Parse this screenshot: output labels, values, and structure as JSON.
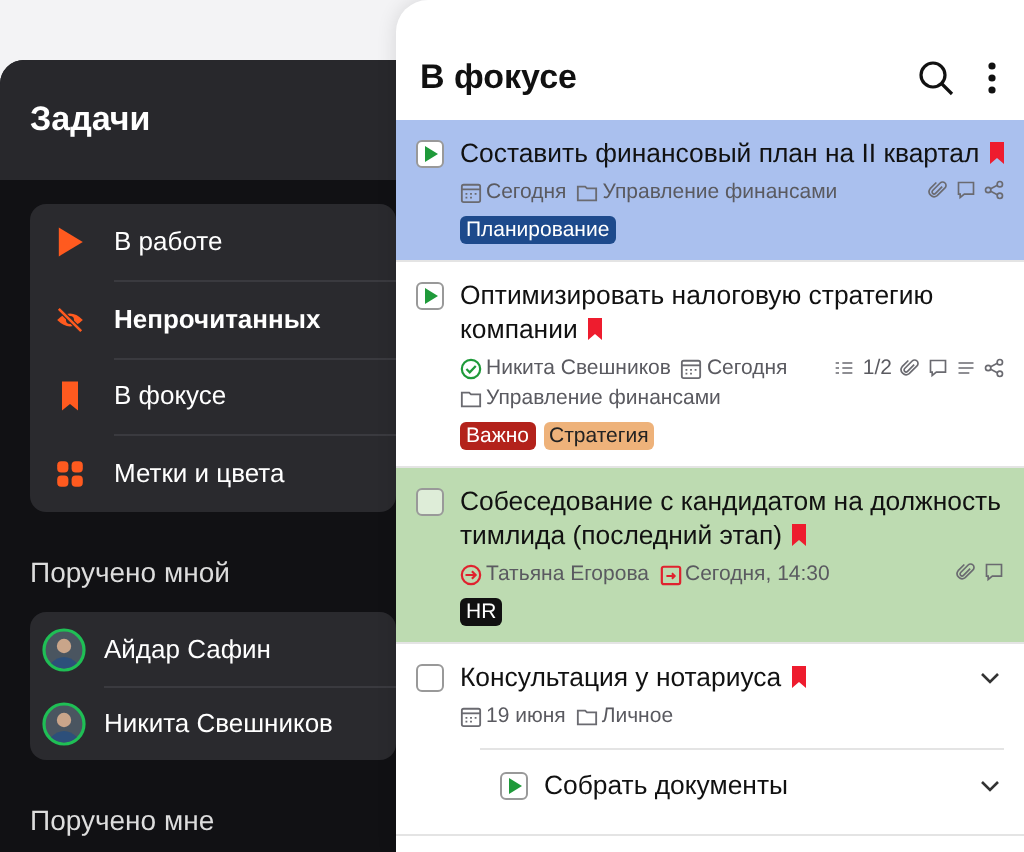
{
  "tasks_panel": {
    "title": "Задачи",
    "filters": [
      {
        "kind": "play",
        "label": "В работе",
        "unread": false
      },
      {
        "kind": "hidden",
        "label": "Непрочитанных",
        "unread": true
      },
      {
        "kind": "bookmark",
        "label": "В фокусе",
        "unread": false
      },
      {
        "kind": "tiles",
        "label": "Метки и цвета",
        "unread": false
      }
    ],
    "assigned_by_me": {
      "title": "Поручено мной",
      "people": [
        {
          "name": "Айдар Сафин"
        },
        {
          "name": "Никита Свешников"
        }
      ]
    },
    "assigned_to_me": {
      "title": "Поручено мне"
    }
  },
  "focus_panel": {
    "title": "В фокусе",
    "tasks": [
      {
        "in_progress": true,
        "title": "Составить финансовый план на II квартал",
        "flagged": true,
        "color": "#aac0ee",
        "meta": [
          {
            "kind": "date",
            "text": "Сегодня"
          },
          {
            "kind": "project",
            "text": "Управление финансами"
          }
        ],
        "actions": [
          {
            "kind": "attach"
          },
          {
            "kind": "comment"
          },
          {
            "kind": "share"
          }
        ],
        "tags": [
          {
            "label": "Планирование",
            "color": "#1d4a8c"
          }
        ]
      },
      {
        "in_progress": true,
        "title": "Оптимизировать налоговую стратегию компании",
        "flagged": true,
        "color": "#ffffff",
        "meta": [
          {
            "kind": "assignee_done",
            "text": "Никита Свешников"
          },
          {
            "kind": "date",
            "text": "Сегодня"
          },
          {
            "kind": "project",
            "text": "Управление финансами"
          }
        ],
        "actions": [
          {
            "kind": "checklist",
            "text": "1/2"
          },
          {
            "kind": "attach"
          },
          {
            "kind": "comment"
          },
          {
            "kind": "notes"
          },
          {
            "kind": "share"
          }
        ],
        "tags": [
          {
            "label": "Важно",
            "color": "#b3221b"
          },
          {
            "label": "Стратегия",
            "color": "#eeb27a"
          }
        ]
      },
      {
        "in_progress": false,
        "title": "Собеседование с кандидатом на должность тимлида (последний этап)",
        "flagged": true,
        "color": "#bddbb1",
        "meta": [
          {
            "kind": "delegated",
            "text": "Татьяна Егорова"
          },
          {
            "kind": "deadline",
            "text": "Сегодня, 14:30"
          }
        ],
        "actions": [
          {
            "kind": "attach"
          },
          {
            "kind": "comment"
          }
        ],
        "tags": [
          {
            "label": "HR",
            "color": "#111111"
          }
        ]
      },
      {
        "in_progress": false,
        "title": "Консультация у нотариуса",
        "flagged": true,
        "color": "#ffffff",
        "expanded": false,
        "meta": [
          {
            "kind": "date",
            "text": "19 июня"
          },
          {
            "kind": "project",
            "text": "Личное"
          }
        ],
        "children": [
          {
            "in_progress": true,
            "title": "Собрать документы",
            "flagged": false,
            "color": "#ffffff",
            "expanded": false
          }
        ]
      }
    ]
  }
}
